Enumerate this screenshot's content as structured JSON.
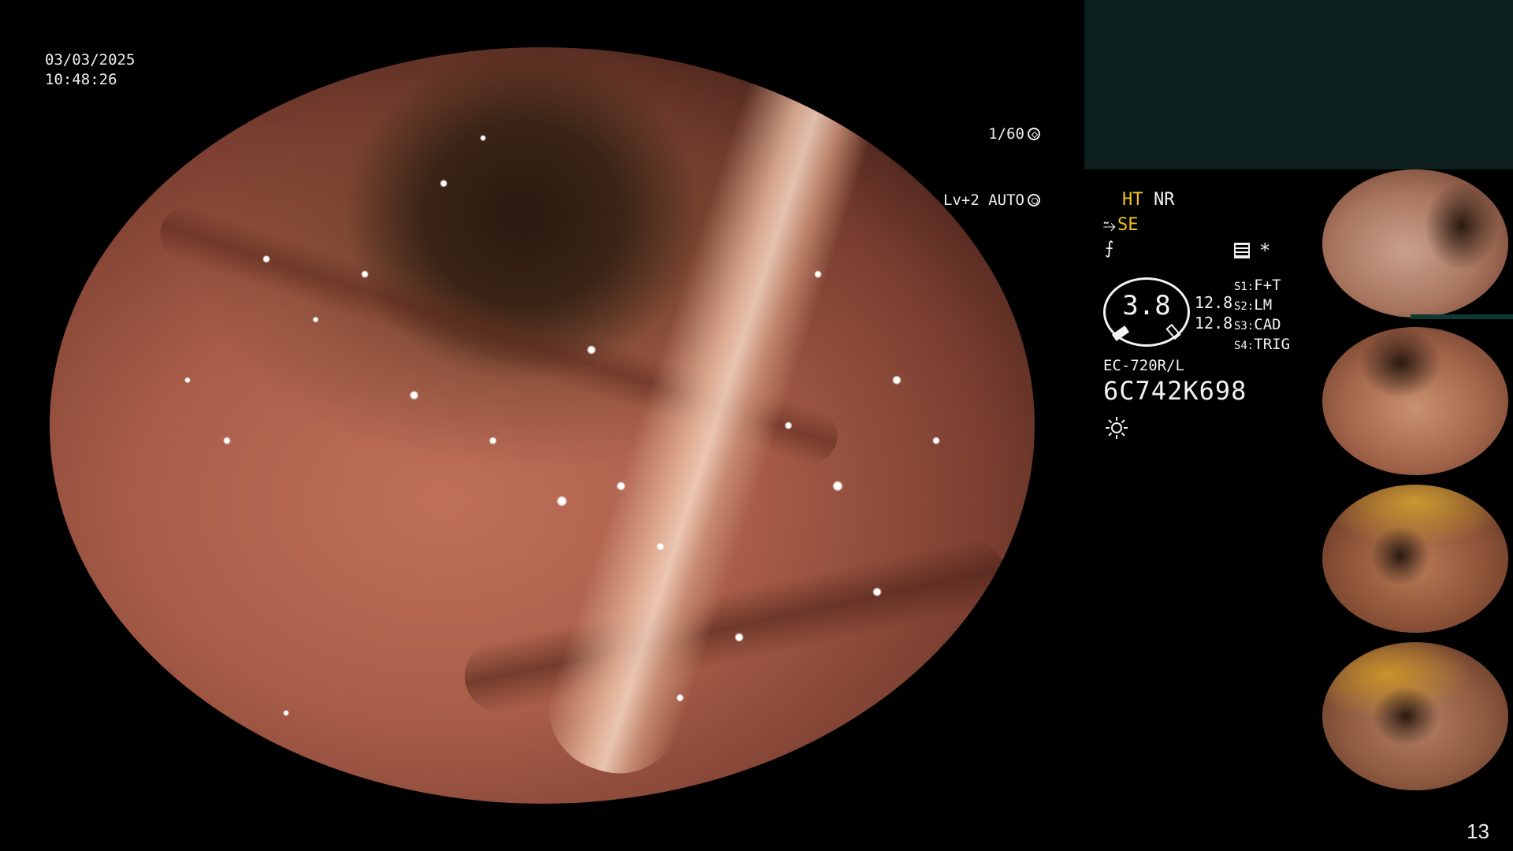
{
  "overlay": {
    "date": "03/03/2025",
    "time": "10:48:26",
    "shutter": "1/60",
    "level_mode": "Lv+2 AUTO"
  },
  "info": {
    "ht": "HT",
    "nr": "NR",
    "se": "SE",
    "magnification": "3.8",
    "value_top": "12.8",
    "value_bottom": "12.8",
    "switches": [
      {
        "key": "S1:",
        "value": "F+T"
      },
      {
        "key": "S2:",
        "value": "LM"
      },
      {
        "key": "S3:",
        "value": "CAD"
      },
      {
        "key": "S4:",
        "value": "TRIG"
      }
    ],
    "scope_model": "EC-720R/L",
    "serial": "6C742K698",
    "asterisk": "*"
  },
  "page_number": "13",
  "colors": {
    "accent_yellow": "#f0c419",
    "panel_teal": "#0c1f1c"
  }
}
